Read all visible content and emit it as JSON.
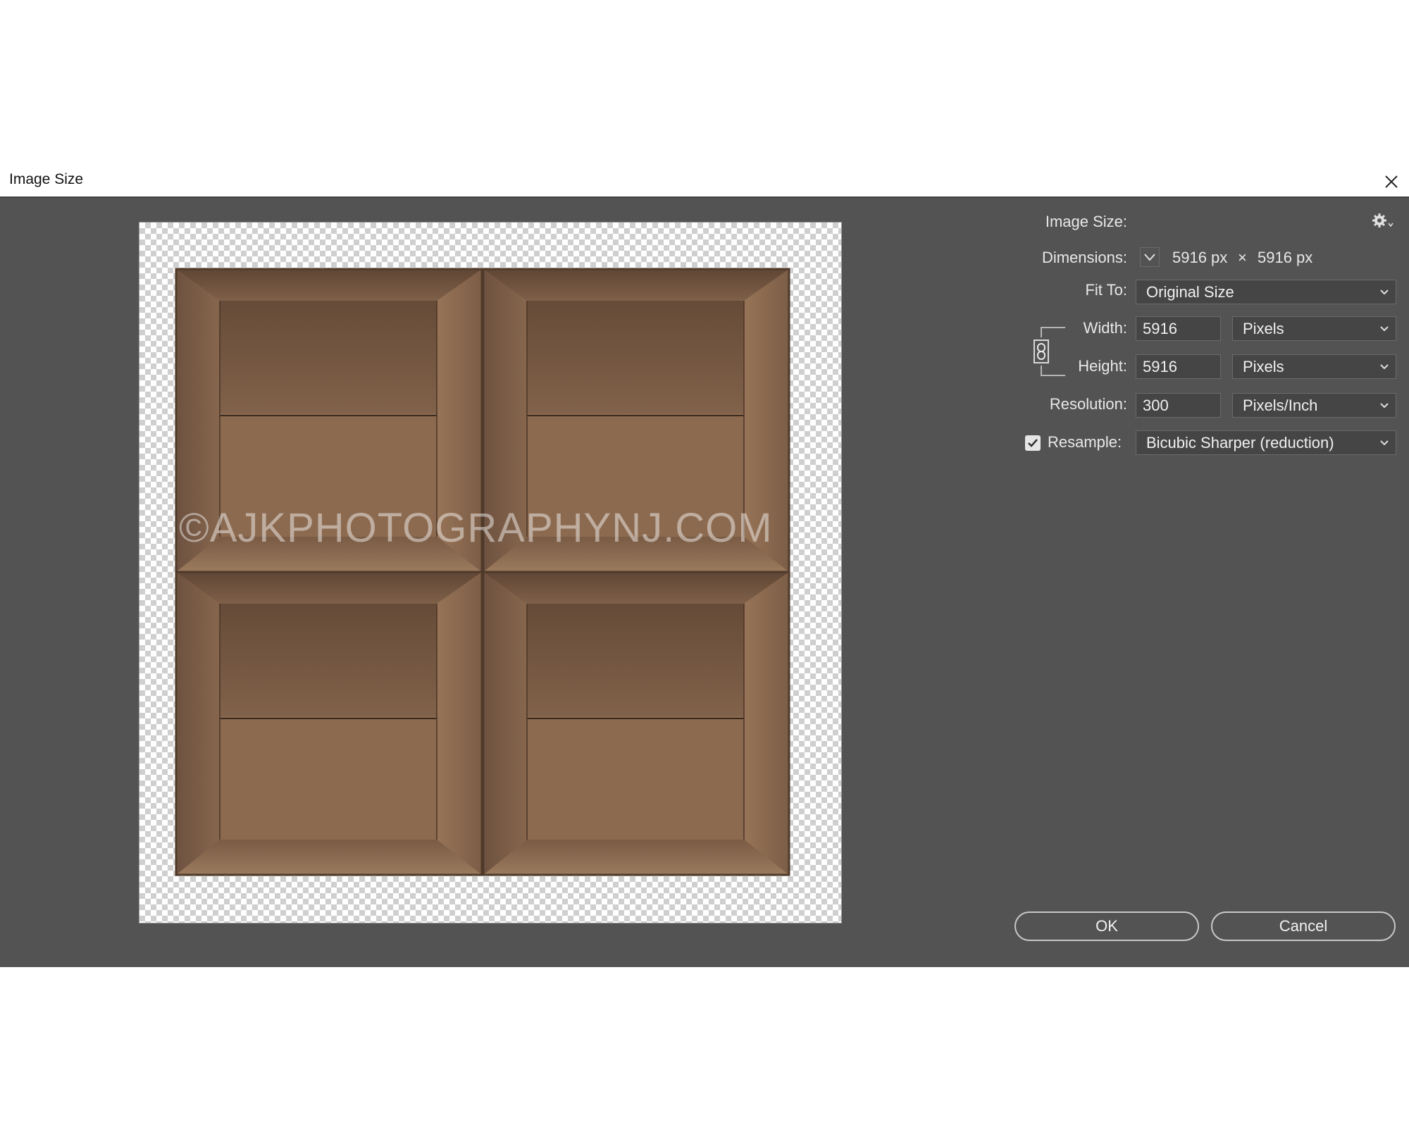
{
  "window": {
    "title": "Image Size"
  },
  "preview": {
    "watermark": "©AJKPHOTOGRAPHYNJ.COM"
  },
  "settings": {
    "image_size_label": "Image Size:",
    "dimensions_label": "Dimensions:",
    "dim_width": "5916 px",
    "dim_times": "×",
    "dim_height": "5916 px",
    "fit_to_label": "Fit To:",
    "fit_to_value": "Original Size",
    "width_label": "Width:",
    "width_value": "5916",
    "width_unit": "Pixels",
    "height_label": "Height:",
    "height_value": "5916",
    "height_unit": "Pixels",
    "resolution_label": "Resolution:",
    "resolution_value": "300",
    "resolution_unit": "Pixels/Inch",
    "resample_label": "Resample:",
    "resample_checked": true,
    "resample_value": "Bicubic Sharper (reduction)"
  },
  "buttons": {
    "ok": "OK",
    "cancel": "Cancel"
  },
  "icons": [
    "close-icon",
    "gear-icon",
    "chevron-down-icon",
    "link-icon",
    "checkbox-checked-icon"
  ],
  "colors": {
    "dialog_bg": "#535353",
    "field_bg": "#454545",
    "cardboard": "#8a6a4e"
  }
}
